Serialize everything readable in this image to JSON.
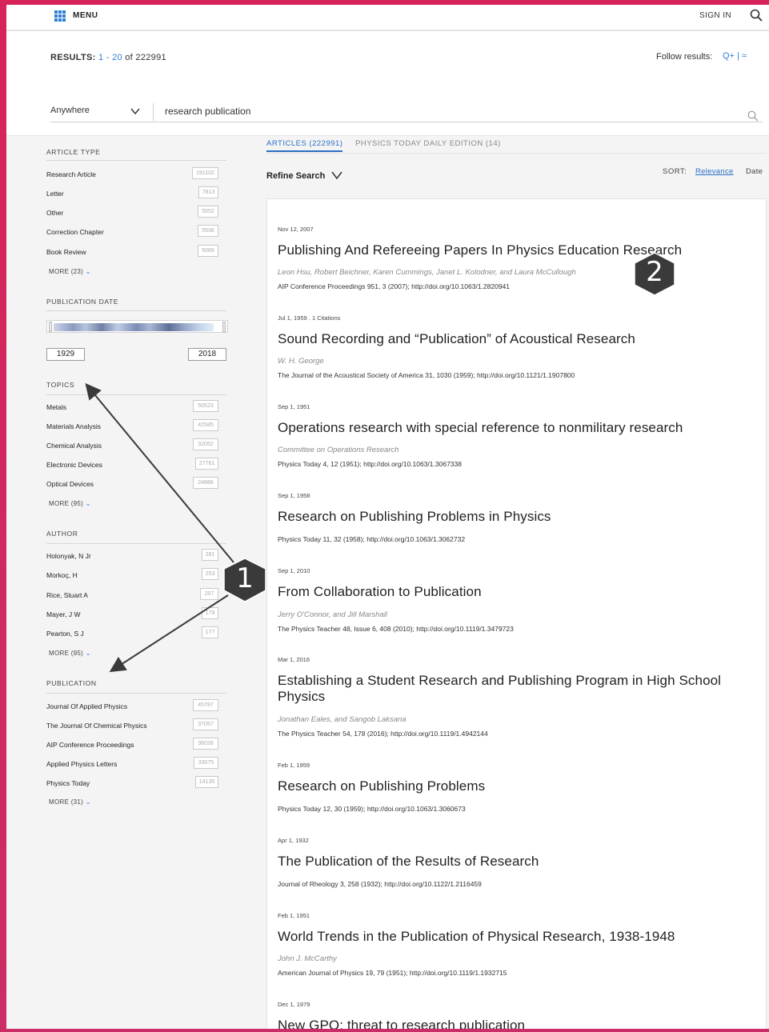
{
  "topbar": {
    "menu_label": "MENU",
    "signin_label": "SIGN IN",
    "search_icon": "search-icon",
    "menu_icon": "grid-icon"
  },
  "summary": {
    "results_label": "RESULTS:",
    "range_start": "1",
    "range_sep": " - ",
    "range_end": "20",
    "of_label": " of ",
    "total": "222991",
    "follow_label": "Follow results:",
    "follow_icons": "Q+ | ≈"
  },
  "search": {
    "scope": "Anywhere",
    "query": "research publication"
  },
  "sidebar": {
    "article_type": {
      "title": "ARTICLE TYPE",
      "items": [
        {
          "label": "Research Article",
          "count": "191102"
        },
        {
          "label": "Letter",
          "count": "7813"
        },
        {
          "label": "Other",
          "count": "5552"
        },
        {
          "label": "Correction Chapter",
          "count": "5536"
        },
        {
          "label": "Book Review",
          "count": "5089"
        }
      ],
      "more": "MORE (23)"
    },
    "publication_date": {
      "title": "PUBLICATION DATE",
      "from": "1929",
      "to": "2018"
    },
    "topics": {
      "title": "TOPICS",
      "items": [
        {
          "label": "Metals",
          "count": "50523"
        },
        {
          "label": "Materials Analysis",
          "count": "42585"
        },
        {
          "label": "Chemical Analysis",
          "count": "32052"
        },
        {
          "label": "Electronic Devices",
          "count": "27761"
        },
        {
          "label": "Optical Devices",
          "count": "24886"
        }
      ],
      "more": "MORE (95)"
    },
    "author": {
      "title": "AUTHOR",
      "items": [
        {
          "label": "Holonyak, N Jr",
          "count": "281"
        },
        {
          "label": "Morkoç, H",
          "count": "253"
        },
        {
          "label": "Rice, Stuart A",
          "count": "207"
        },
        {
          "label": "Mayer, J W",
          "count": "179"
        },
        {
          "label": "Pearton, S J",
          "count": "177"
        }
      ],
      "more": "MORE (95)"
    },
    "publication": {
      "title": "PUBLICATION",
      "items": [
        {
          "label": "Journal Of Applied Physics",
          "count": "45787"
        },
        {
          "label": "The Journal Of Chemical Physics",
          "count": "37057"
        },
        {
          "label": "AIP Conference Proceedings",
          "count": "36026"
        },
        {
          "label": "Applied Physics Letters",
          "count": "33075"
        },
        {
          "label": "Physics Today",
          "count": "14135"
        }
      ],
      "more": "MORE (31)"
    }
  },
  "tabs": {
    "articles": "ARTICLES (222991)",
    "physics_today": "PHYSICS TODAY DAILY EDITION (14)"
  },
  "toolbar": {
    "refine": "Refine Search",
    "sort_label": "SORT:",
    "sort_relevance": "Relevance",
    "sort_date": "Date"
  },
  "results": [
    {
      "date": "Nov 12, 2007",
      "title": "Publishing And Refereeing Papers In Physics Education Research",
      "authors": "Leon Hsu, Robert Beichner, Karen Cummings, Janet L. Kolodner, and Laura McCullough",
      "citation": "AIP Conference Proceedings 951, 3 (2007); http://doi.org/10.1063/1.2820941"
    },
    {
      "date": "Jul 1, 1959 . 1 Citations",
      "title": "Sound Recording and “Publication” of Acoustical Research",
      "authors": "W. H. George",
      "citation": "The Journal of the Acoustical Society of America 31, 1030 (1959); http://doi.org/10.1121/1.1907800"
    },
    {
      "date": "Sep 1, 1951",
      "title": "Operations research with special reference to nonmilitary research",
      "authors": "Committee on Operations Research",
      "citation": "Physics Today 4, 12 (1951); http://doi.org/10.1063/1.3067338"
    },
    {
      "date": "Sep 1, 1958",
      "title": "Research on Publishing Problems in Physics",
      "authors": "",
      "citation": "Physics Today 11, 32 (1958); http://doi.org/10.1063/1.3062732"
    },
    {
      "date": "Sep 1, 2010",
      "title": "From Collaboration to Publication",
      "authors": "Jerry O'Connor, and Jill Marshall",
      "citation": "The Physics Teacher 48, Issue 6, 408 (2010); http://doi.org/10.1119/1.3479723"
    },
    {
      "date": "Mar 1, 2016",
      "title": "Establishing a Student Research and Publishing Program in High School Physics",
      "authors": "Jonathan Eales, and Sangob Laksana",
      "citation": "The Physics Teacher 54, 178 (2016); http://doi.org/10.1119/1.4942144"
    },
    {
      "date": "Feb 1, 1959",
      "title": "Research on Publishing Problems",
      "authors": "",
      "citation": "Physics Today 12, 30 (1959); http://doi.org/10.1063/1.3060673"
    },
    {
      "date": "Apr 1, 1932",
      "title": "The Publication of the Results of Research",
      "authors": "",
      "citation": "Journal of Rheology 3, 258 (1932); http://doi.org/10.1122/1.2116459"
    },
    {
      "date": "Feb 1, 1951",
      "title": "World Trends in the Publication of Physical Research, 1938-1948",
      "authors": "John J. McCarthy",
      "citation": "American Journal of Physics 19, 79 (1951); http://doi.org/10.1119/1.1932715"
    },
    {
      "date": "Dec 1, 1979",
      "title": "New GPO: threat to research publication",
      "authors": "",
      "citation": ""
    }
  ],
  "annotations": {
    "marker1": "1",
    "marker2": "2",
    "marker_color": "#3a3a3a"
  }
}
